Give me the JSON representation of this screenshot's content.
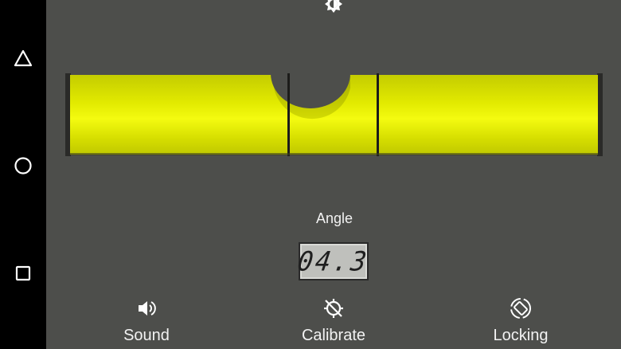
{
  "level": {
    "angle_label": "Angle",
    "angle_value": "04.3"
  },
  "actions": [
    {
      "label": "Sound",
      "icon": "volume-icon"
    },
    {
      "label": "Calibrate",
      "icon": "calibrate-icon"
    },
    {
      "label": "Locking",
      "icon": "screen-rotation-icon"
    }
  ],
  "navigation": {
    "buttons": [
      "back-triangle-icon",
      "home-circle-icon",
      "recents-square-icon"
    ]
  },
  "colors": {
    "background": "#4d4e4b",
    "vial_yellow": "#dfe600",
    "navbar": "#000000",
    "text": "#f2f2f2"
  }
}
